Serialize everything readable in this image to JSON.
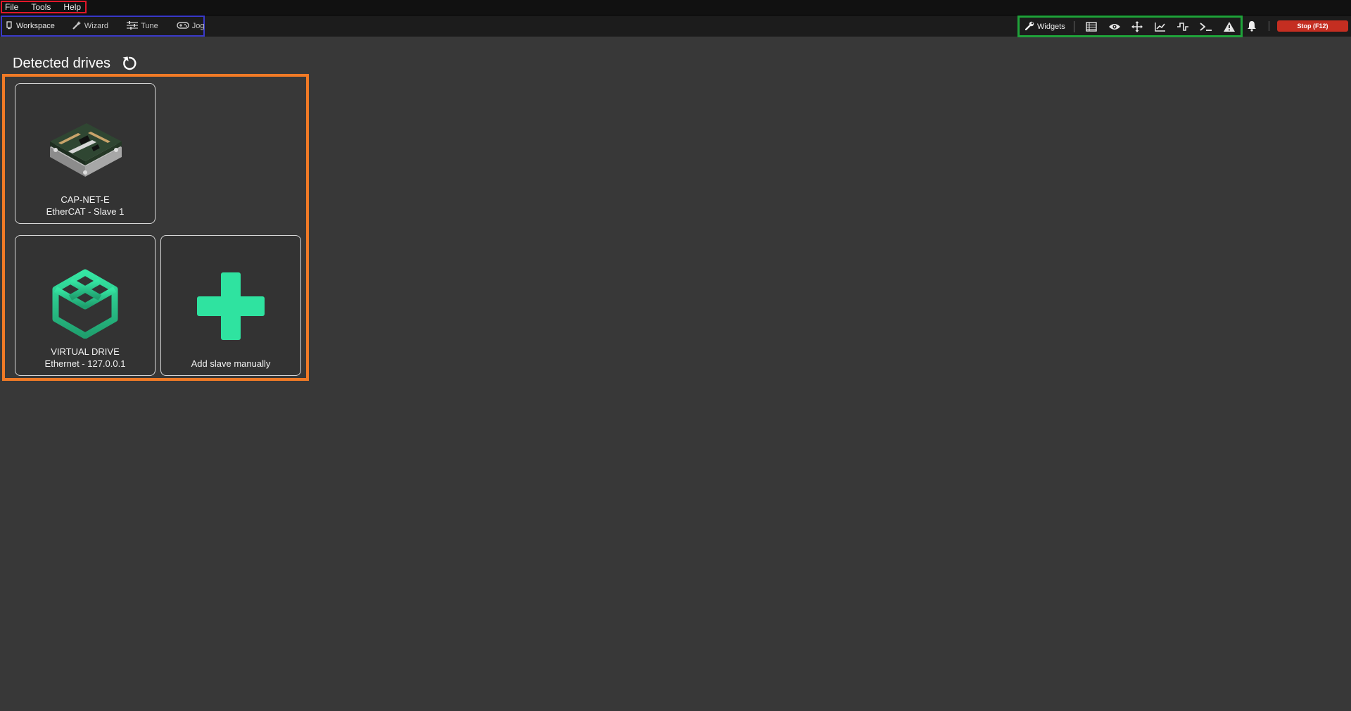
{
  "menu": {
    "items": [
      "File",
      "Tools",
      "Help"
    ]
  },
  "nav": {
    "workspace": "Workspace",
    "wizard": "Wizard",
    "tune": "Tune",
    "jog": "Jog"
  },
  "widgets": {
    "label": "Widgets",
    "icons": [
      "register-table-icon",
      "eye-icon",
      "move-arrows-icon",
      "chart-line-icon",
      "signal-step-icon",
      "terminal-icon",
      "warning-icon"
    ]
  },
  "stop_label": "Stop (F12)",
  "main": {
    "title": "Detected drives",
    "drives": [
      {
        "name": "CAP-NET-E",
        "connection": "EtherCAT - Slave 1",
        "icon": "drive-board-image"
      },
      {
        "name": "VIRTUAL DRIVE",
        "connection": "Ethernet - 127.0.0.1",
        "icon": "virtual-drive-cube-icon"
      }
    ],
    "add_label": "Add slave manually"
  },
  "colors": {
    "accent_green": "#2fe3a0",
    "stop_red": "#c42e21",
    "background": "#383838"
  }
}
